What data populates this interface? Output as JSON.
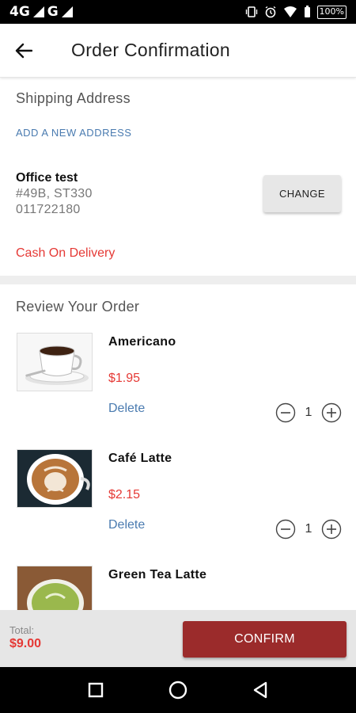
{
  "status_bar": {
    "network_1": "4G",
    "network_2": "G",
    "battery": "100%"
  },
  "header": {
    "title": "Order Confirmation"
  },
  "shipping": {
    "section_title": "Shipping Address",
    "add_address_label": "ADD A NEW ADDRESS",
    "address": {
      "name": "Office test",
      "line1": "#49B, ST330",
      "phone": "011722180"
    },
    "change_label": "CHANGE",
    "payment_method": "Cash On Delivery"
  },
  "review": {
    "section_title": "Review Your Order",
    "items": [
      {
        "name": "Americano",
        "price": "$1.95",
        "delete_label": "Delete",
        "quantity": "1",
        "image": "americano-cup-image"
      },
      {
        "name": "Café Latte",
        "price": "$2.15",
        "delete_label": "Delete",
        "quantity": "1",
        "image": "latte-art-image"
      },
      {
        "name": "Green Tea Latte",
        "price": "",
        "delete_label": "",
        "quantity": "",
        "image": "green-tea-latte-image"
      }
    ]
  },
  "footer": {
    "total_label": "Total:",
    "total_value": "$9.00",
    "confirm_label": "CONFIRM"
  },
  "colors": {
    "accent_red": "#e53935",
    "link_blue": "#4a7bb0",
    "confirm_button": "#9b2b2b"
  }
}
